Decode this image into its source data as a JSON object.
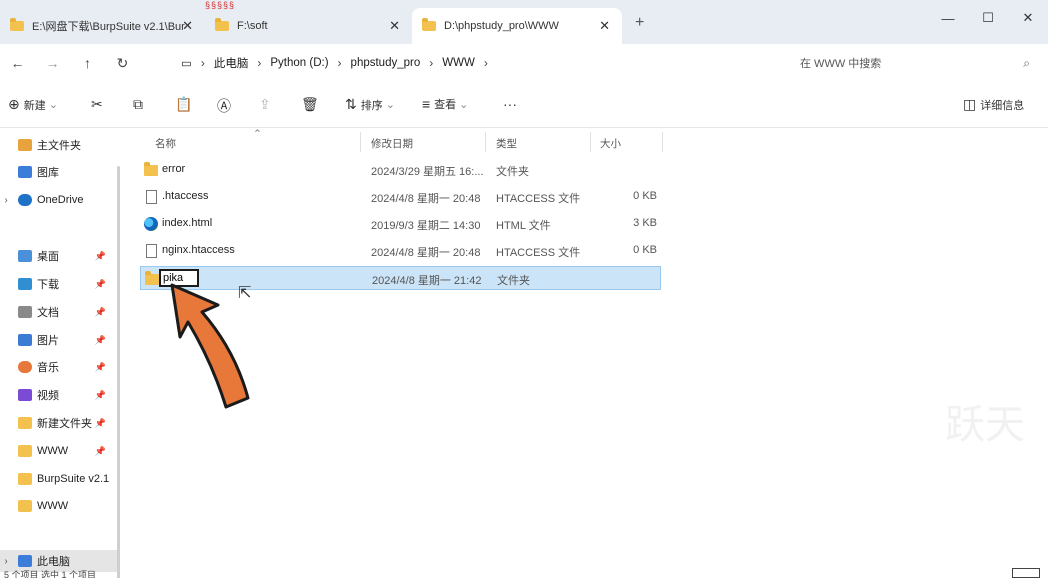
{
  "tabs": [
    {
      "title": "E:\\网盘下载\\BurpSuite v2.1\\Bur",
      "close": "✕"
    },
    {
      "title": "F:\\soft",
      "close": "✕"
    },
    {
      "title": "D:\\phpstudy_pro\\WWW",
      "close": "✕"
    }
  ],
  "new_tab": "+",
  "window_controls": {
    "minimize": "—",
    "maximize": "☐",
    "close": "✕"
  },
  "top_red_mark": "§§§§§",
  "address": {
    "back": "←",
    "forward": "→",
    "up": "↑",
    "refresh": "↻",
    "monitor_icon": "▭",
    "crumbs": [
      "此电脑",
      "Python (D:)",
      "phpstudy_pro",
      "WWW"
    ],
    "separator": "›",
    "search_placeholder": "在 WWW 中搜索",
    "search_icon": "⌕"
  },
  "commands": {
    "new_label": "新建",
    "new_icon": "⊕",
    "cut_icon": "✂",
    "copy_icon": "⧉",
    "paste_icon": "📋",
    "rename_icon": "Ⓐ",
    "share_icon": "⇪",
    "delete_icon": "🗑",
    "sort_label": "排序",
    "sort_icon": "⇅",
    "view_label": "查看",
    "view_icon": "≡",
    "more_icon": "···",
    "details_label": "详细信息",
    "details_icon": "◫",
    "dropdown": "⌄"
  },
  "sidebar": {
    "items": [
      {
        "label": "主文件夹",
        "color": "#e8a33d",
        "chev": ""
      },
      {
        "label": "图库",
        "color": "#3b7dd8",
        "chev": ""
      },
      {
        "label": "OneDrive",
        "color": "#1e73c8",
        "chev": "›"
      },
      {
        "label": "桌面",
        "color": "#4a90d9",
        "chev": "",
        "pin": "📌"
      },
      {
        "label": "下载",
        "color": "#2f8fd1",
        "chev": "",
        "pin": "📌"
      },
      {
        "label": "文档",
        "color": "#8a8a8a",
        "chev": "",
        "pin": "📌"
      },
      {
        "label": "图片",
        "color": "#3c7bd4",
        "chev": "",
        "pin": "📌"
      },
      {
        "label": "音乐",
        "color": "#e5783a",
        "chev": "",
        "pin": "📌"
      },
      {
        "label": "视频",
        "color": "#7b4bd6",
        "chev": "",
        "pin": "📌"
      },
      {
        "label": "新建文件夹",
        "color": "#f2c14e",
        "chev": "",
        "pin": "📌"
      },
      {
        "label": "WWW",
        "color": "#f2c14e",
        "chev": "",
        "pin": "📌"
      },
      {
        "label": "BurpSuite v2.1",
        "color": "#f2c14e",
        "chev": ""
      },
      {
        "label": "WWW",
        "color": "#f2c14e",
        "chev": ""
      },
      {
        "label": "此电脑",
        "color": "#3b7dd8",
        "chev": "›"
      }
    ]
  },
  "columns": {
    "name": "名称",
    "modified": "修改日期",
    "type": "类型",
    "size": "大小",
    "sort_arrow": "⌃"
  },
  "files": [
    {
      "name": "error",
      "date": "2024/3/29 星期五 16:...",
      "type": "文件夹",
      "size": "",
      "kind": "folder"
    },
    {
      "name": ".htaccess",
      "date": "2024/4/8 星期一 20:48",
      "type": "HTACCESS 文件",
      "size": "0 KB",
      "kind": "doc"
    },
    {
      "name": "index.html",
      "date": "2019/9/3 星期二 14:30",
      "type": "HTML 文件",
      "size": "3 KB",
      "kind": "edge"
    },
    {
      "name": "nginx.htaccess",
      "date": "2024/4/8 星期一 20:48",
      "type": "HTACCESS 文件",
      "size": "0 KB",
      "kind": "doc"
    },
    {
      "name": "pika",
      "date": "2024/4/8 星期一 21:42",
      "type": "文件夹",
      "size": "",
      "kind": "folder",
      "renaming": true
    }
  ],
  "status": "5 个项目   选中 1 个项目",
  "watermark": "跃天",
  "colors": {
    "selection": "#cce4f7",
    "selection_border": "#99c9ef",
    "arrow": "#e8773a",
    "tabstrip": "#e8edf3"
  }
}
